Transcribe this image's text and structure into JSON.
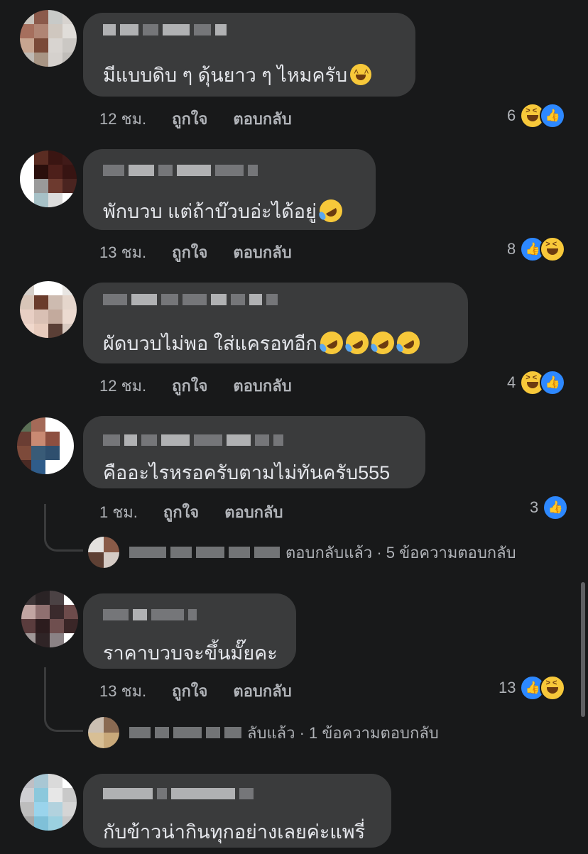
{
  "comments": [
    {
      "text": "มีแบบดิบ ๆ ดุ้นยาว ๆ ไหมครับ",
      "time": "12 ชม.",
      "like_label": "ถูกใจ",
      "reply_label": "ตอบกลับ",
      "reaction_count": "6",
      "reactions": [
        "haha",
        "like"
      ]
    },
    {
      "text": "พักบวบ แต่ถ้าบ๊วบอ่ะได้อยู่",
      "time": "13 ชม.",
      "like_label": "ถูกใจ",
      "reply_label": "ตอบกลับ",
      "reaction_count": "8",
      "reactions": [
        "like",
        "haha"
      ]
    },
    {
      "text": "ผัดบวบไม่พอ ใส่แครอทอีก",
      "time": "12 ชม.",
      "like_label": "ถูกใจ",
      "reply_label": "ตอบกลับ",
      "reaction_count": "4",
      "reactions": [
        "haha",
        "like"
      ]
    },
    {
      "text": "คืออะไรหรอครับตามไม่ทันครับ555",
      "time": "1 ชม.",
      "like_label": "ถูกใจ",
      "reply_label": "ตอบกลับ",
      "reaction_count": "3",
      "reactions": [
        "like"
      ],
      "replies_summary": "ตอบกลับแล้ว · 5 ข้อความตอบกลับ"
    },
    {
      "text": "ราคาบวบจะขึ้นมั๊ยคะ",
      "time": "13 ชม.",
      "like_label": "ถูกใจ",
      "reply_label": "ตอบกลับ",
      "reaction_count": "13",
      "reactions": [
        "like",
        "haha"
      ],
      "replies_summary": "ลับแล้ว · 1 ข้อความตอบกลับ"
    },
    {
      "text": "กับข้าวน่ากินทุกอย่างเลยค่ะแพรี่"
    }
  ],
  "colors": {
    "background": "#18191a",
    "bubble": "#3a3b3c",
    "text": "#e4e6eb",
    "secondary_text": "#b0b3b8",
    "like_blue": "#2d88ff",
    "haha_yellow": "#f7c83a"
  }
}
